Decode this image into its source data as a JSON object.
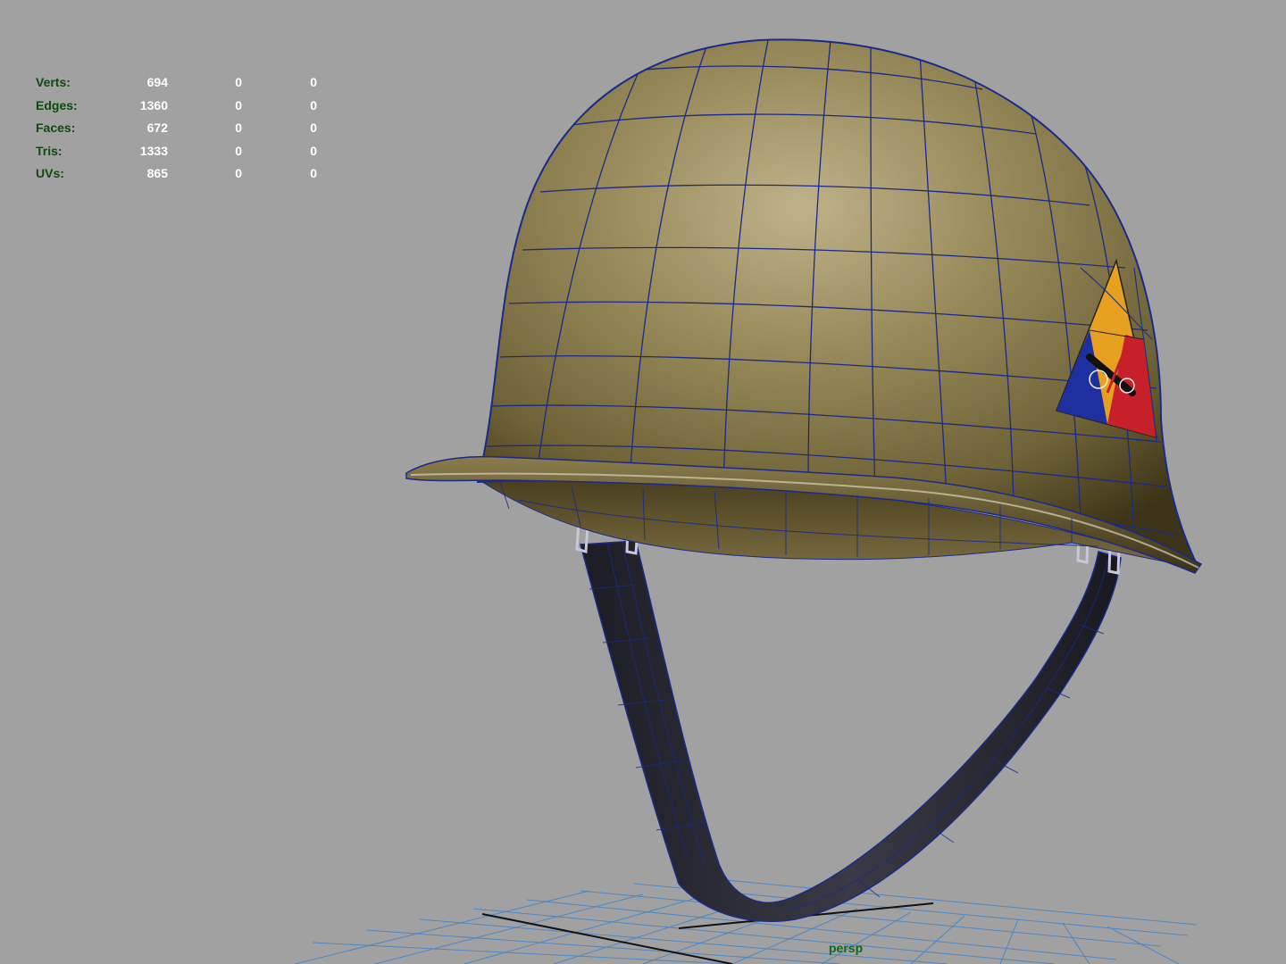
{
  "hud": {
    "rows": [
      {
        "label": "Verts:",
        "v1": "694",
        "v2": "0",
        "v3": "0"
      },
      {
        "label": "Edges:",
        "v1": "1360",
        "v2": "0",
        "v3": "0"
      },
      {
        "label": "Faces:",
        "v1": "672",
        "v2": "0",
        "v3": "0"
      },
      {
        "label": "Tris:",
        "v1": "1333",
        "v2": "0",
        "v3": "0"
      },
      {
        "label": "UVs:",
        "v1": "865",
        "v2": "0",
        "v3": "0"
      }
    ]
  },
  "viewport": {
    "camera": "persp",
    "background_color": "#a1a1a1",
    "grid_color": "#2f7fd0",
    "wireframe_color": "#1a2a8a",
    "helmet_color": "#7a6c3e"
  }
}
